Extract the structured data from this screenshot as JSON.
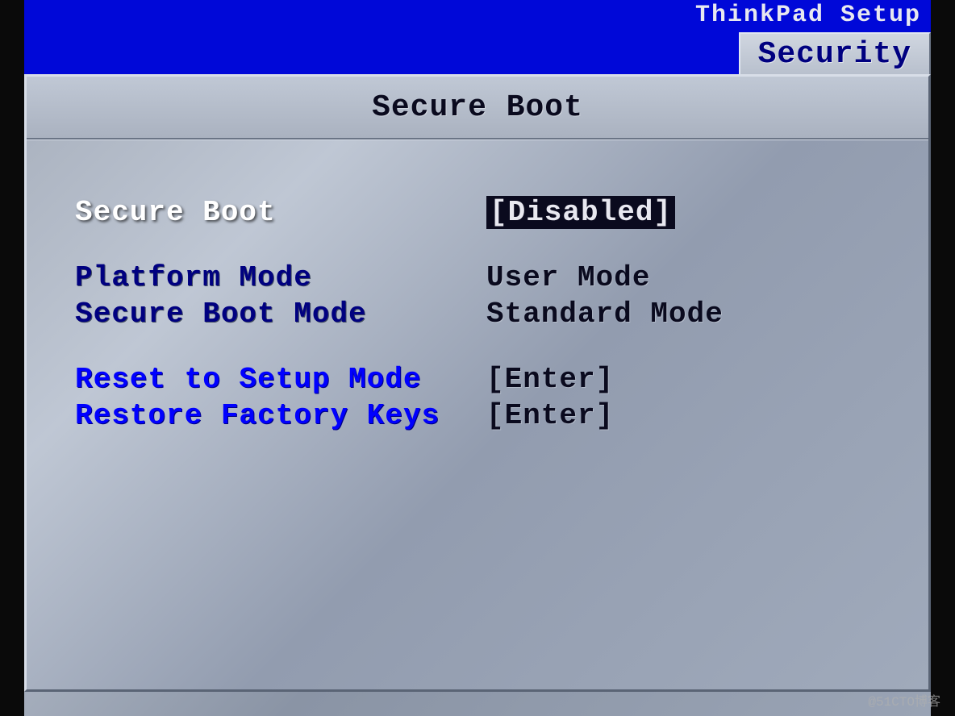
{
  "header": {
    "title": "ThinkPad Setup",
    "active_tab": "Security"
  },
  "section": {
    "title": "Secure Boot"
  },
  "items": {
    "secure_boot": {
      "label": "Secure Boot",
      "value": "[Disabled]"
    },
    "platform_mode": {
      "label": "Platform Mode",
      "value": "User Mode"
    },
    "secure_boot_mode": {
      "label": "Secure Boot Mode",
      "value": "Standard Mode"
    },
    "reset_setup_mode": {
      "label": "Reset to Setup Mode",
      "value": "[Enter]"
    },
    "restore_factory_keys": {
      "label": "Restore Factory Keys",
      "value": "[Enter]"
    }
  },
  "watermark": "@51CTO博客"
}
